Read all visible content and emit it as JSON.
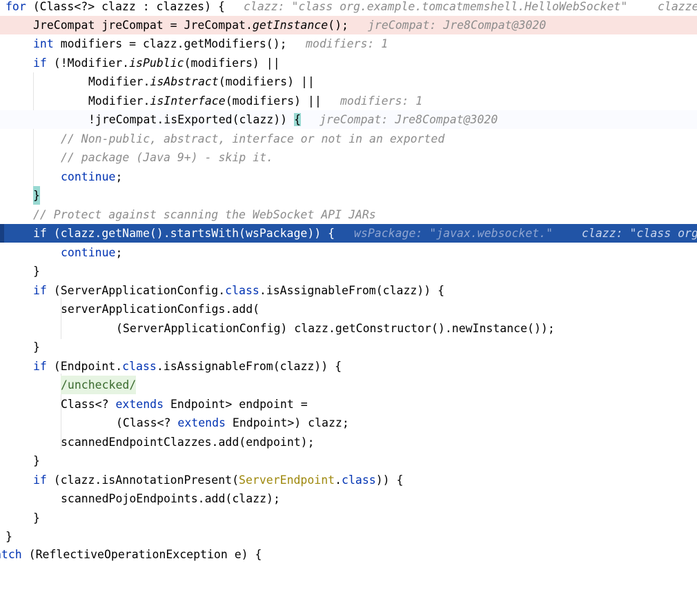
{
  "editor": {
    "lines": [
      {
        "a": "for",
        "b": " (Class<?> clazz : clazzes) {",
        "hint": "clazz: \"class org.example.tomcatmemshell.HelloWebSocket\"",
        "hint2": "clazze"
      },
      {
        "a": "JreCompat jreCompat = JreCompat.",
        "b": "getInstance",
        "c": "();",
        "hint": "jreCompat: Jre8Compat@3020"
      },
      {
        "a": "int",
        "b": " modifiers = clazz.getModifiers();",
        "hint": "modifiers: 1"
      },
      {
        "a": "if",
        "b": " (!Modifier.",
        "c": "isPublic",
        "d": "(modifiers) ||"
      },
      {
        "a": "Modifier.",
        "b": "isAbstract",
        "c": "(modifiers) ||"
      },
      {
        "a": "Modifier.",
        "b": "isInterface",
        "c": "(modifiers) ||",
        "hint": "modifiers: 1"
      },
      {
        "a": "!jreCompat.isExported(clazz)) ",
        "b": "{",
        "hint": "jreCompat: Jre8Compat@3020"
      },
      {
        "a": "// Non-public, abstract, interface or not in an exported"
      },
      {
        "a": "// package (Java 9+) - skip it."
      },
      {
        "a": "continue",
        "b": ";"
      },
      {
        "a": "}"
      },
      {
        "a": "// Protect against scanning the WebSocket API JARs"
      },
      {
        "a": "if (clazz.getName().startsWith(wsPackage)) {",
        "hint": "wsPackage: \"javax.websocket.\"",
        "hint2": "clazz: \"class org"
      },
      {
        "a": "continue",
        "b": ";"
      },
      {
        "a": "}"
      },
      {
        "a": "if",
        "b": " (ServerApplicationConfig.",
        "c": "class",
        "d": ".isAssignableFrom(clazz)) {"
      },
      {
        "a": "serverApplicationConfigs.add("
      },
      {
        "a": "(ServerApplicationConfig) clazz.getConstructor().newInstance());"
      },
      {
        "a": "}"
      },
      {
        "a": "if",
        "b": " (Endpoint.",
        "c": "class",
        "d": ".isAssignableFrom(clazz)) {"
      },
      {
        "a": "/unchecked/"
      },
      {
        "a": "Class<? ",
        "b": "extends",
        "c": " Endpoint> endpoint ="
      },
      {
        "a": "(Class<? ",
        "b": "extends",
        "c": " Endpoint>) clazz;"
      },
      {
        "a": "scannedEndpointClazzes.add(endpoint);"
      },
      {
        "a": "}"
      },
      {
        "a": "if",
        "b": " (clazz.isAnnotationPresent(",
        "c": "ServerEndpoint",
        "d": ".",
        "e": "class",
        "f": ")) {"
      },
      {
        "a": "scannedPojoEndpoints.add(clazz);"
      },
      {
        "a": "}"
      },
      {
        "a": "}"
      },
      {
        "a": "atch",
        "b": " (ReflectiveOperationException e) {"
      }
    ]
  },
  "colors": {
    "keyword": "#0033b3",
    "current_line": "#2154a6",
    "breakpoint_line": "#fae3e0",
    "string": "#c07a16",
    "comment": "#8c8c8c",
    "annotation": "#9e880d"
  }
}
